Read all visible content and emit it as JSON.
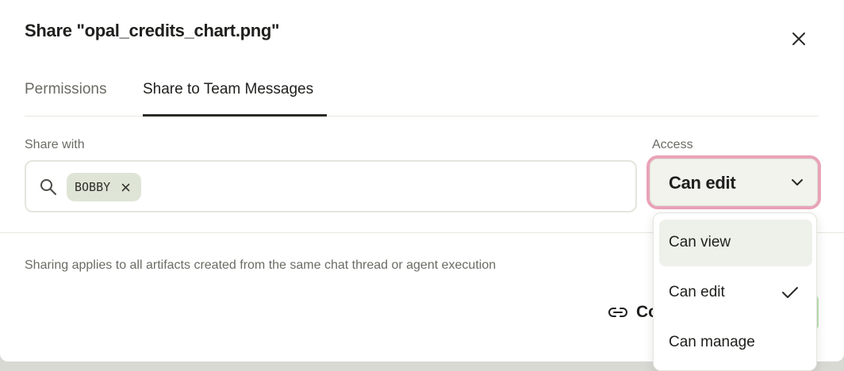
{
  "dialog": {
    "title": "Share \"opal_credits_chart.png\""
  },
  "tabs": [
    {
      "label": "Permissions",
      "active": false
    },
    {
      "label": "Share to Team Messages",
      "active": true
    }
  ],
  "share_with": {
    "label": "Share with",
    "chips": [
      {
        "label": "BOBBY"
      }
    ]
  },
  "access": {
    "label": "Access",
    "selected": "Can edit",
    "options": [
      {
        "label": "Can view",
        "hovered": true
      },
      {
        "label": "Can edit",
        "checked": true
      },
      {
        "label": "Can manage"
      }
    ]
  },
  "note": "Sharing applies to all artifacts created from the same chat thread or agent execution",
  "footer": {
    "copy_link_label": "Co"
  },
  "icons": {
    "close": "close-icon",
    "search": "search-icon",
    "chip_remove": "close-icon",
    "chevron": "chevron-down-icon",
    "check": "check-icon",
    "link": "link-icon"
  },
  "colors": {
    "focus_ring": "#e9a3b9",
    "chip_bg": "#dfe5d6",
    "option_hover": "#eef1ea",
    "primary_button": "#bfe2b6"
  }
}
